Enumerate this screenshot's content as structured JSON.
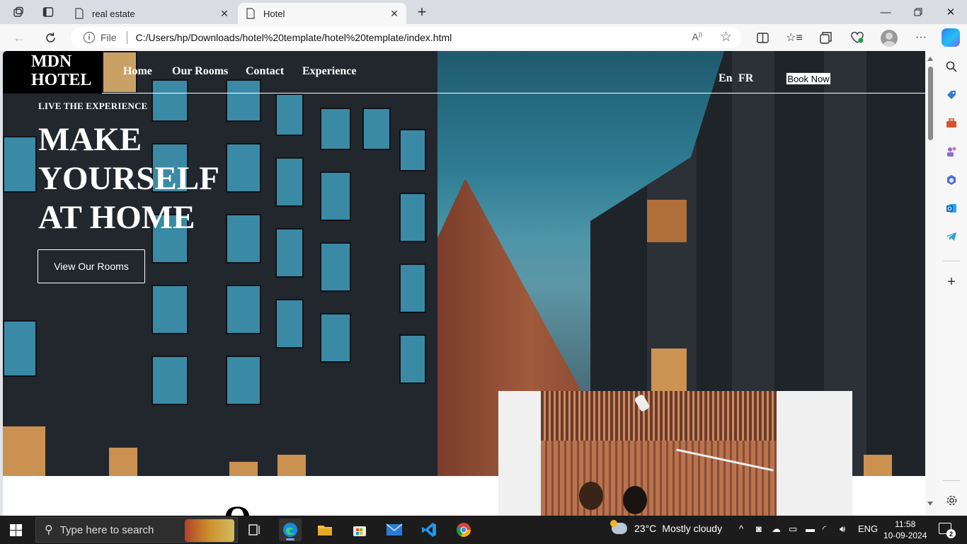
{
  "browser": {
    "tabs": [
      {
        "title": "real estate",
        "active": false
      },
      {
        "title": "Hotel",
        "active": true
      }
    ],
    "address": {
      "scheme_label": "File",
      "url": "C:/Users/hp/Downloads/hotel%20template/hotel%20template/index.html"
    },
    "icons": {
      "workspaces": "workspaces-icon",
      "tab_actions": "tab-actions-icon",
      "back": "back-arrow-icon",
      "refresh": "refresh-icon",
      "read_aloud": "read-aloud-icon",
      "favorite": "star-icon",
      "split_screen": "split-screen-icon",
      "favorites": "favorites-icon",
      "collections": "collections-icon",
      "browser_essentials": "browser-essentials-icon",
      "more": "more-icon",
      "copilot": "copilot-icon"
    },
    "sidebar": [
      "search-icon",
      "shopping-tag-icon",
      "tools-icon",
      "games-icon",
      "office-icon",
      "outlook-icon",
      "telegram-icon",
      "add-icon",
      "settings-icon"
    ]
  },
  "site": {
    "logo": "MDN HOTEL",
    "nav": [
      "Home",
      "Our Rooms",
      "Contact",
      "Experience"
    ],
    "languages": [
      "En",
      "FR"
    ],
    "book_now": "Book Now",
    "tagline": "LIVE THE EXPERIENCE",
    "headline": "MAKE YOURSELF AT HOME",
    "cta": "View Our Rooms",
    "next_section_partial": "O"
  },
  "taskbar": {
    "search_placeholder": "Type here to search",
    "apps": [
      "task-view-icon",
      "edge-icon",
      "file-explorer-icon",
      "store-icon",
      "mail-icon",
      "vscode-icon",
      "chrome-icon"
    ],
    "weather": {
      "temp": "23°C",
      "condition": "Mostly cloudy",
      "alert_count": "1"
    },
    "language": "ENG",
    "time": "11:58",
    "date": "10-09-2024",
    "notifications": "2"
  },
  "colors": {
    "browser_chrome": "#d9dde3",
    "toolbar": "#f7f7f7",
    "taskbar": "#1c1c1c",
    "logo_bg": "#000000",
    "hero_text": "#ffffff"
  }
}
